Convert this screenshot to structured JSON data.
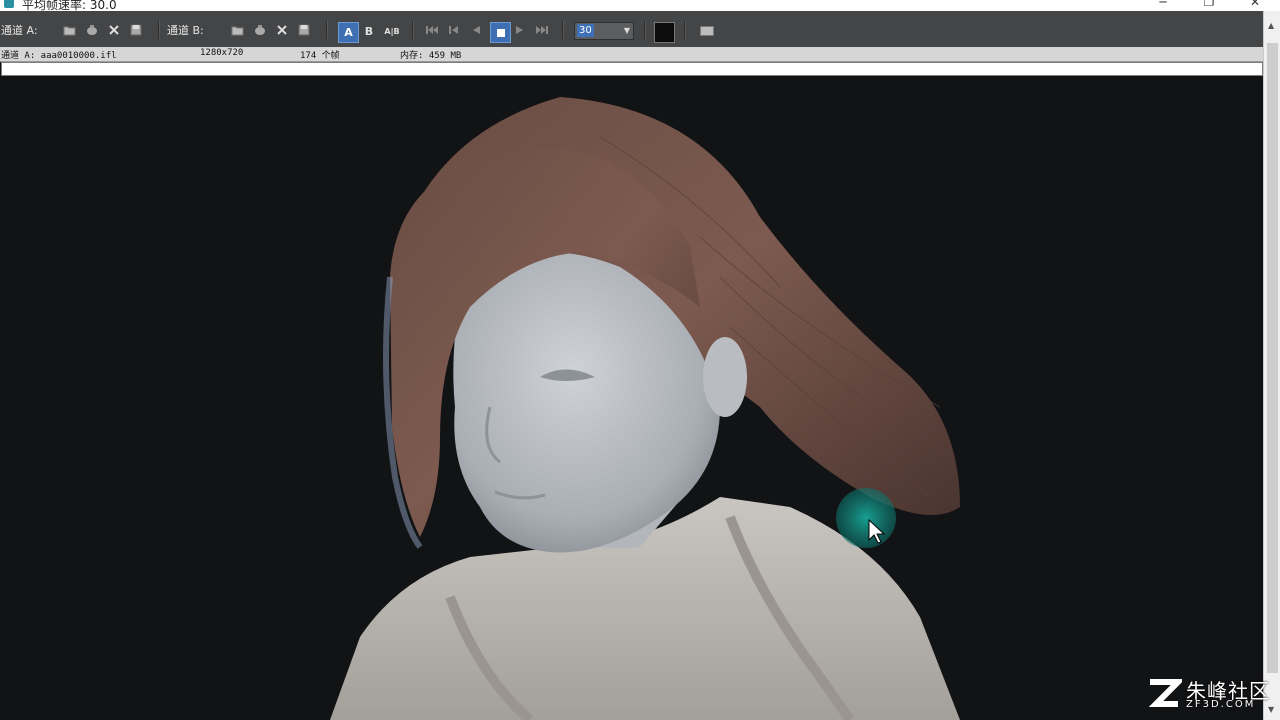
{
  "window": {
    "title": "平均帧速率: 30.0",
    "minimize": "─",
    "restore": "❐",
    "close": "✕"
  },
  "toolbar": {
    "channel_a_label": "通道 A:",
    "channel_b_label": "通道 B:",
    "button_a": "A",
    "button_b": "B",
    "button_ab": "A|B",
    "fps_value": "30",
    "icons": [
      "open-folder-icon",
      "stop-render-icon",
      "clear-icon",
      "save-icon",
      "goto-start-icon",
      "prev-frame-icon",
      "play-backward-icon",
      "stop-icon",
      "play-forward-icon",
      "goto-end-icon",
      "display-icon"
    ]
  },
  "info": {
    "channel": "通道 A: aaa0010000.ifl",
    "resolution": "1280x720",
    "frames": "174 个帧",
    "memory": "内存: 459 MB"
  },
  "watermark": {
    "name": "朱峰社区",
    "url": "ZF3D.COM"
  }
}
